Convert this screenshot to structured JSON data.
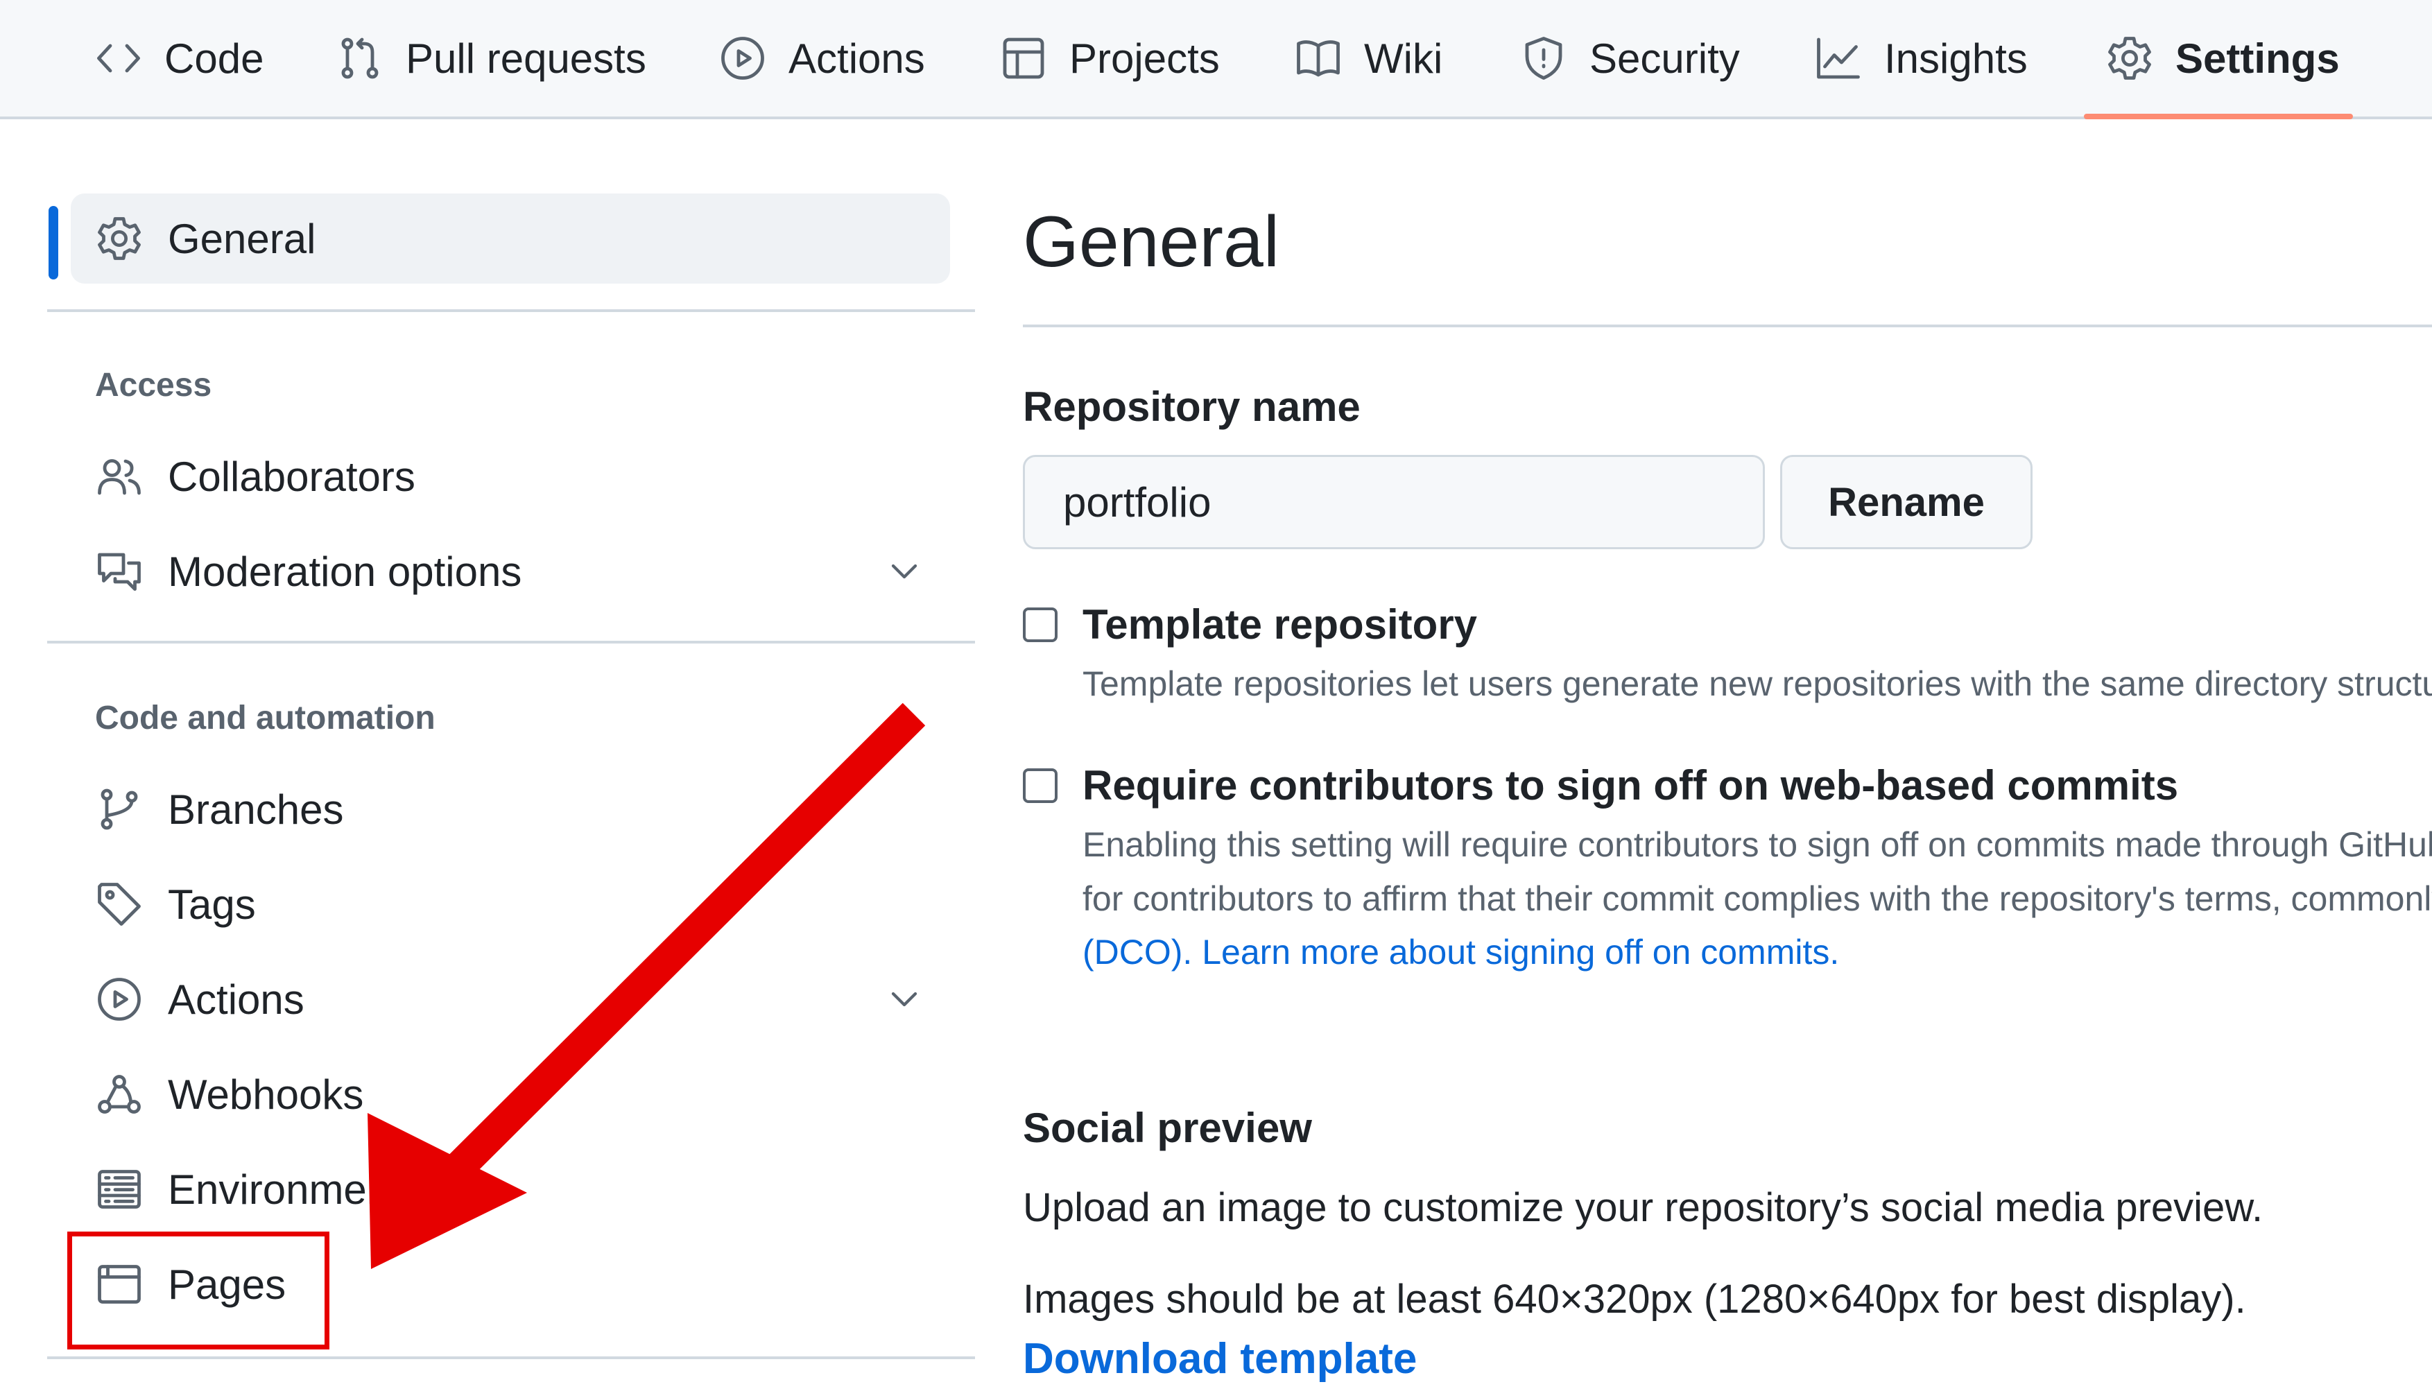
{
  "topnav": {
    "tabs": [
      {
        "label": "Code",
        "icon": "code-icon"
      },
      {
        "label": "Pull requests",
        "icon": "git-pull-request-icon"
      },
      {
        "label": "Actions",
        "icon": "play-icon"
      },
      {
        "label": "Projects",
        "icon": "table-icon"
      },
      {
        "label": "Wiki",
        "icon": "book-icon"
      },
      {
        "label": "Security",
        "icon": "shield-icon"
      },
      {
        "label": "Insights",
        "icon": "graph-icon"
      },
      {
        "label": "Settings",
        "icon": "gear-icon",
        "selected": true
      }
    ]
  },
  "sidebar": {
    "general": "General",
    "access_heading": "Access",
    "collaborators": "Collaborators",
    "moderation_options": "Moderation options",
    "code_automation_heading": "Code and automation",
    "branches": "Branches",
    "tags": "Tags",
    "actions": "Actions",
    "webhooks": "Webhooks",
    "environments": "Environments",
    "pages": "Pages"
  },
  "main": {
    "title": "General",
    "repo_name_label": "Repository name",
    "repo_name_value": "portfolio",
    "rename_button": "Rename",
    "template_repo": {
      "title": "Template repository",
      "desc": "Template repositories let users generate new repositories with the same directory structure and files."
    },
    "signoff": {
      "title": "Require contributors to sign off on web-based commits",
      "desc_line1": "Enabling this setting will require contributors to sign off on commits made through GitHub’s web interface. Signing off is a way",
      "desc_line2": "for contributors to affirm that their commit complies with the repository's terms, commonly the Developer Certificate of Origin",
      "desc_dco": "(DCO).",
      "desc_link": "Learn more about signing off on commits."
    },
    "social_preview": {
      "heading": "Social preview",
      "line1": "Upload an image to customize your repository’s social media preview.",
      "line2": "Images should be at least 640×320px (1280×640px for best display).",
      "download_link": "Download template"
    }
  },
  "colors": {
    "accent": "#0969da",
    "tab_underline": "#fd8c73",
    "annotation_red": "#e60000"
  }
}
